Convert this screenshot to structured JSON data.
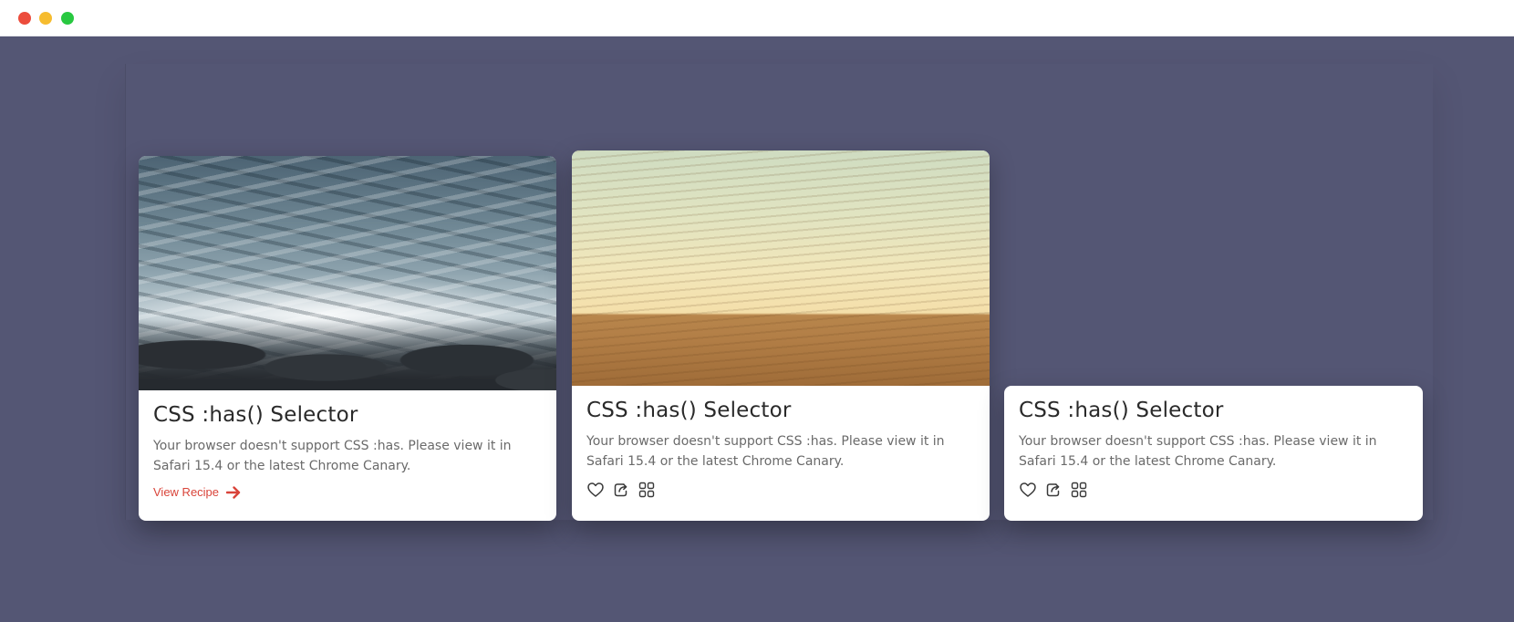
{
  "cards": [
    {
      "title": "CSS :has() Selector",
      "description": "Your browser doesn't support CSS :has. Please view it in Safari 15.4 or the latest Chrome Canary.",
      "link_label": "View Recipe",
      "image": "ocean-waves-photo",
      "icon": "arrow-right-icon"
    },
    {
      "title": "CSS :has() Selector",
      "description": "Your browser doesn't support CSS :has. Please view it in Safari 15.4 or the latest Chrome Canary.",
      "image": "desert-horizon-photo",
      "icons": [
        "heart-icon",
        "share-icon",
        "grid-icon"
      ]
    },
    {
      "title": "CSS :has() Selector",
      "description": "Your browser doesn't support CSS :has. Please view it in Safari 15.4 or the latest Chrome Canary.",
      "icons": [
        "heart-icon",
        "share-icon",
        "grid-icon"
      ]
    }
  ],
  "colors": {
    "background": "#545674",
    "card": "#ffffff",
    "accent": "#d9443a",
    "title": "#2a2a2a",
    "text": "#6a6a6a"
  }
}
